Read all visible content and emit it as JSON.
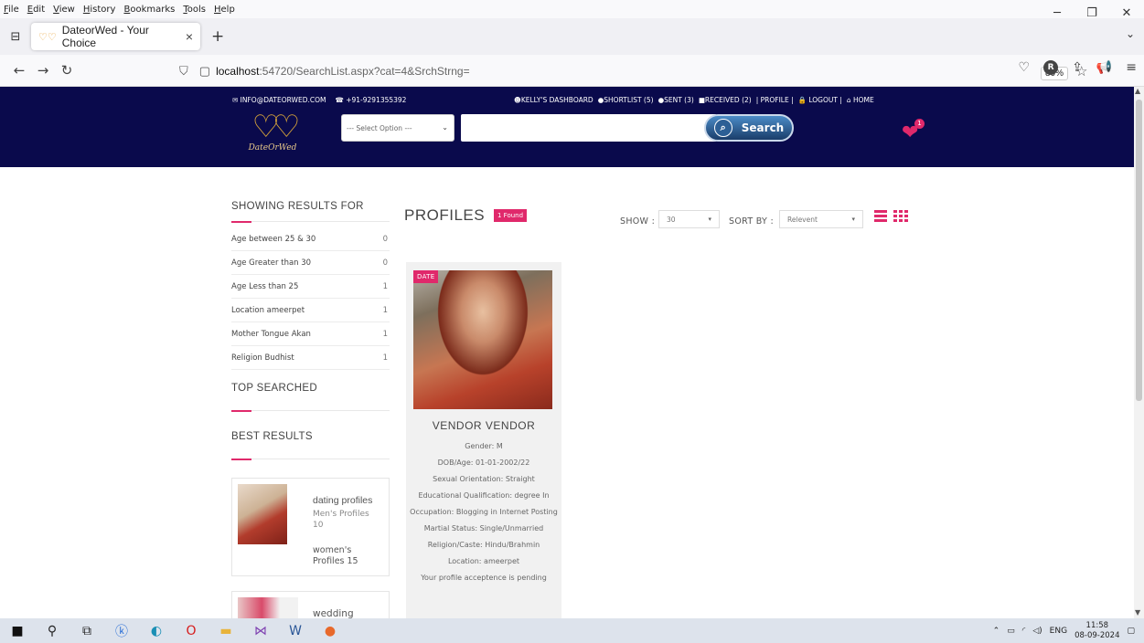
{
  "browser": {
    "menu": [
      "File",
      "Edit",
      "View",
      "History",
      "Bookmarks",
      "Tools",
      "Help"
    ],
    "tab_title": "DateorWed - Your Choice",
    "url_host": "localhost",
    "url_path": ":54720/SearchList.aspx?cat=4&SrchStrng=",
    "zoom": "80%",
    "profile_initial": "R"
  },
  "header": {
    "email": "INFO@DATEORWED.COM",
    "phone": "+91-9291355392",
    "links": [
      "KELLY'S DASHBOARD",
      "SHORTLIST (5)",
      "SENT (3)",
      "RECEIVED (2)",
      "| PROFILE |",
      "LOGOUT |",
      "HOME"
    ],
    "logo_text": "DateOrWed",
    "select_placeholder": "--- Select Option ---",
    "search_label": "Search",
    "cart_count": "1"
  },
  "sidebar": {
    "showing_title": "SHOWING RESULTS FOR",
    "filters": [
      {
        "label": "Age between 25 & 30",
        "count": "0"
      },
      {
        "label": "Age Greater than 30",
        "count": "0"
      },
      {
        "label": "Age Less than 25",
        "count": "1"
      },
      {
        "label": "Location ameerpet",
        "count": "1"
      },
      {
        "label": "Mother Tongue Akan",
        "count": "1"
      },
      {
        "label": "Religion Budhist",
        "count": "1"
      }
    ],
    "top_searched_title": "TOP SEARCHED",
    "best_results_title": "BEST RESULTS",
    "best1_title": "dating profiles",
    "best1_sub": "Men's Profiles 10",
    "best1_sub2": "women's Profiles 15",
    "best2_title": "wedding"
  },
  "main": {
    "title": "PROFILES",
    "found_badge": "1 Found",
    "show_label": "SHOW :",
    "show_value": "30",
    "sort_label": "SORT BY :",
    "sort_value": "Relevent"
  },
  "card": {
    "tag": "DATE",
    "name": "VENDOR VENDOR",
    "lines": [
      "Gender: M",
      "DOB/Age: 01-01-2002/22",
      "Sexual Orientation: Straight",
      "Educational Qualification: degree In",
      "Occupation: Blogging in Internet Posting",
      "Martial Status: Single/Unmarried",
      "Religion/Caste: Hindu/Brahmin",
      "Location: ameerpet",
      "Your profile acceptence is pending"
    ]
  },
  "taskbar": {
    "lang": "ENG",
    "time": "11:58",
    "date": "08-09-2024"
  }
}
